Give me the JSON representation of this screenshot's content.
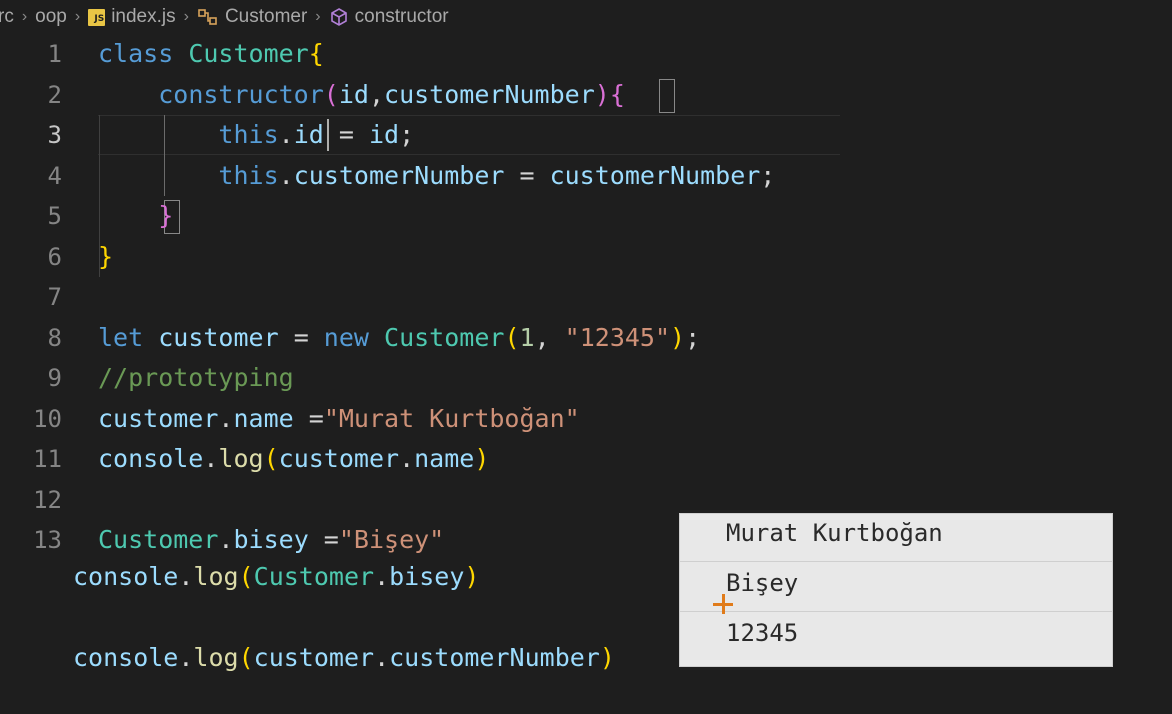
{
  "breadcrumb": {
    "items": [
      {
        "label": "rc"
      },
      {
        "label": "oop"
      },
      {
        "label": "index.js",
        "icon": "js-file-icon"
      },
      {
        "label": "Customer",
        "icon": "class-icon"
      },
      {
        "label": "constructor",
        "icon": "cube-icon"
      }
    ],
    "separator": "›"
  },
  "editor": {
    "line_numbers": [
      "1",
      "2",
      "3",
      "4",
      "5",
      "6",
      "7",
      "8",
      "9",
      "10",
      "11",
      "12",
      "13"
    ],
    "active_line": "3",
    "lines": [
      [
        {
          "t": "class ",
          "c": "kw"
        },
        {
          "t": "Customer",
          "c": "cls"
        },
        {
          "t": "{",
          "c": "br1"
        }
      ],
      [
        {
          "t": "    "
        },
        {
          "t": "constructor",
          "c": "kw"
        },
        {
          "t": "(",
          "c": "br2"
        },
        {
          "t": "id",
          "c": "var"
        },
        {
          "t": ",",
          "c": "pun"
        },
        {
          "t": "customerNumber",
          "c": "var"
        },
        {
          "t": ")",
          "c": "br2"
        },
        {
          "t": "{",
          "c": "br2"
        }
      ],
      [
        {
          "t": "        "
        },
        {
          "t": "this",
          "c": "kw"
        },
        {
          "t": ".",
          "c": "pun"
        },
        {
          "t": "id",
          "c": "var"
        },
        {
          "t": " = ",
          "c": "pun"
        },
        {
          "t": "id",
          "c": "var"
        },
        {
          "t": ";",
          "c": "pun"
        }
      ],
      [
        {
          "t": "        "
        },
        {
          "t": "this",
          "c": "kw"
        },
        {
          "t": ".",
          "c": "pun"
        },
        {
          "t": "customerNumber",
          "c": "var"
        },
        {
          "t": " = ",
          "c": "pun"
        },
        {
          "t": "customerNumber",
          "c": "var"
        },
        {
          "t": ";",
          "c": "pun"
        }
      ],
      [
        {
          "t": "    "
        },
        {
          "t": "}",
          "c": "br2"
        }
      ],
      [
        {
          "t": "}",
          "c": "br1"
        }
      ],
      [],
      [
        {
          "t": "let ",
          "c": "kw"
        },
        {
          "t": "customer",
          "c": "var"
        },
        {
          "t": " = ",
          "c": "pun"
        },
        {
          "t": "new ",
          "c": "kw"
        },
        {
          "t": "Customer",
          "c": "cls"
        },
        {
          "t": "(",
          "c": "br1"
        },
        {
          "t": "1",
          "c": "num"
        },
        {
          "t": ", ",
          "c": "pun"
        },
        {
          "t": "\"12345\"",
          "c": "str"
        },
        {
          "t": ")",
          "c": "br1"
        },
        {
          "t": ";",
          "c": "pun"
        }
      ],
      [
        {
          "t": "//prototyping",
          "c": "cmt"
        }
      ],
      [
        {
          "t": "customer",
          "c": "var"
        },
        {
          "t": ".",
          "c": "pun"
        },
        {
          "t": "name",
          "c": "var"
        },
        {
          "t": " =",
          "c": "pun"
        },
        {
          "t": "\"Murat Kurtboğan\"",
          "c": "str"
        }
      ],
      [
        {
          "t": "console",
          "c": "var"
        },
        {
          "t": ".",
          "c": "pun"
        },
        {
          "t": "log",
          "c": "fn"
        },
        {
          "t": "(",
          "c": "br1"
        },
        {
          "t": "customer",
          "c": "var"
        },
        {
          "t": ".",
          "c": "pun"
        },
        {
          "t": "name",
          "c": "var"
        },
        {
          "t": ")",
          "c": "br1"
        }
      ],
      [],
      [
        {
          "t": "Customer",
          "c": "cls"
        },
        {
          "t": ".",
          "c": "pun"
        },
        {
          "t": "bisey",
          "c": "var"
        },
        {
          "t": " =",
          "c": "pun"
        },
        {
          "t": "\"Bişey\"",
          "c": "str"
        }
      ],
      [
        {
          "t": "console",
          "c": "var"
        },
        {
          "t": ".",
          "c": "pun"
        },
        {
          "t": "log",
          "c": "fn"
        },
        {
          "t": "(",
          "c": "br1"
        },
        {
          "t": "Customer",
          "c": "cls"
        },
        {
          "t": ".",
          "c": "pun"
        },
        {
          "t": "bisey",
          "c": "var"
        },
        {
          "t": ")",
          "c": "br1"
        }
      ],
      [],
      [
        {
          "t": "console",
          "c": "var"
        },
        {
          "t": ".",
          "c": "pun"
        },
        {
          "t": "log",
          "c": "fn"
        },
        {
          "t": "(",
          "c": "br1"
        },
        {
          "t": "customer",
          "c": "var"
        },
        {
          "t": ".",
          "c": "pun"
        },
        {
          "t": "customerNumber",
          "c": "var"
        },
        {
          "t": ")",
          "c": "br1"
        }
      ]
    ]
  },
  "output": {
    "lines": [
      "Murat Kurtboğan",
      "Bişey",
      "12345"
    ]
  },
  "colors": {
    "background": "#1e1e1e",
    "keyword": "#569cd6",
    "class": "#4ec9b0",
    "string": "#ce9178",
    "comment": "#6a9955",
    "output_background": "#e8e8e8",
    "pointer": "#e07b1a"
  }
}
